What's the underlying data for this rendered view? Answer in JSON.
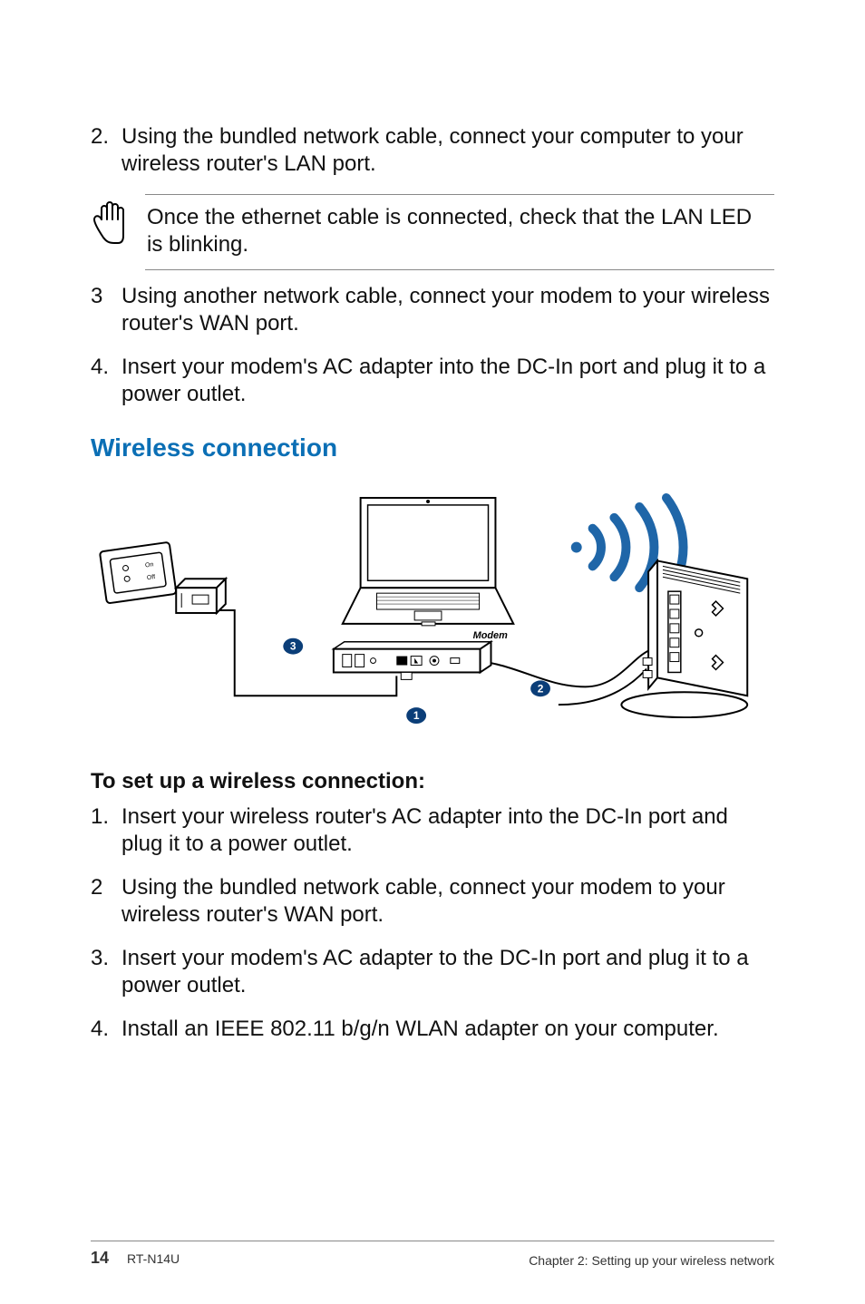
{
  "steps_top": [
    {
      "num": "2.",
      "text": "Using the bundled network cable, connect your computer to your wireless router's LAN port."
    }
  ],
  "note": "Once the ethernet cable is connected, check that the LAN LED is blinking.",
  "steps_mid": [
    {
      "num": "3",
      "text": "Using another network cable, connect your modem to your wireless router's WAN port."
    },
    {
      "num": "4.",
      "text": "Insert your modem's AC adapter into the DC-In port and plug it to a power outlet."
    }
  ],
  "section_heading": "Wireless connection",
  "diagram": {
    "label_modem": "Modem",
    "callout_1": "1",
    "callout_2": "2",
    "callout_3": "3"
  },
  "sub_heading": "To set up a wireless connection:",
  "steps_bottom": [
    {
      "num": "1.",
      "text": "Insert your wireless router's AC adapter into the DC-In port and plug it to a power outlet."
    },
    {
      "num": "2",
      "text": "Using the bundled network cable, connect your modem to your wireless router's WAN port."
    },
    {
      "num": "3.",
      "text": "Insert your modem's AC adapter to the DC-In port and plug it to a power outlet."
    },
    {
      "num": "4.",
      "text": "Install an IEEE 802.11 b/g/n WLAN adapter on your computer."
    }
  ],
  "footer": {
    "page_number": "14",
    "model": "RT-N14U",
    "chapter": "Chapter 2: Setting up your wireless network"
  }
}
